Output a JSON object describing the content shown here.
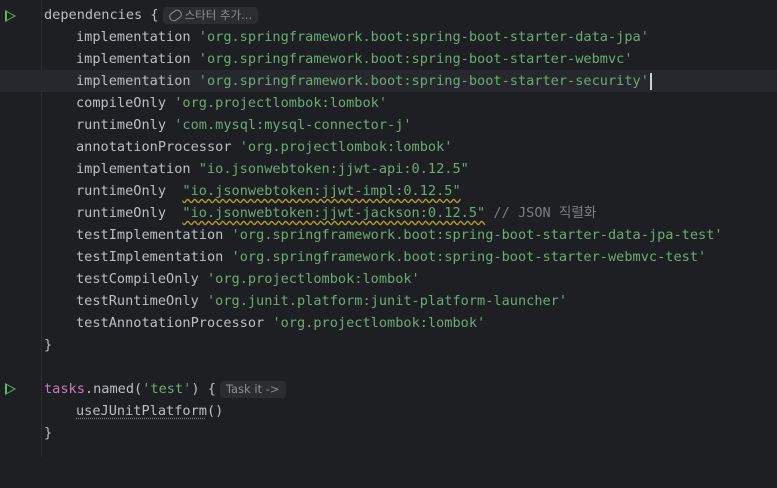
{
  "editor": {
    "lines": [
      {
        "kw": "dependencies {",
        "hint": "스타터 추가..."
      },
      {
        "fn": "implementation",
        "s": "'org.springframework.boot:spring-boot-starter-data-jpa'"
      },
      {
        "fn": "implementation",
        "s": "'org.springframework.boot:spring-boot-starter-webmvc'"
      },
      {
        "fn": "implementation",
        "s": "'org.springframework.boot:spring-boot-starter-security'"
      },
      {
        "fn": "compileOnly",
        "s": "'org.projectlombok:lombok'"
      },
      {
        "fn": "runtimeOnly",
        "s": "'com.mysql:mysql-connector-j'"
      },
      {
        "fn": "annotationProcessor",
        "s": "'org.projectlombok:lombok'"
      },
      {
        "fn": "implementation",
        "s": "\"io.jsonwebtoken:jjwt-api:0.12.5\""
      },
      {
        "fn": "runtimeOnly ",
        "s": "\"io.jsonwebtoken:jjwt-impl:0.12.5\""
      },
      {
        "fn": "runtimeOnly ",
        "s": "\"io.jsonwebtoken:jjwt-jackson:0.12.5\"",
        "c": "// JSON 직렬화"
      },
      {
        "fn": "testImplementation",
        "s": "'org.springframework.boot:spring-boot-starter-data-jpa-test'"
      },
      {
        "fn": "testImplementation",
        "s": "'org.springframework.boot:spring-boot-starter-webmvc-test'"
      },
      {
        "fn": "testCompileOnly",
        "s": "'org.projectlombok:lombok'"
      },
      {
        "fn": "testRuntimeOnly",
        "s": "'org.junit.platform:junit-platform-launcher'"
      },
      {
        "fn": "testAnnotationProcessor",
        "s": "'org.projectlombok:lombok'"
      },
      {
        "kw": "}"
      },
      {
        "kw": ""
      },
      {
        "tasks": "tasks",
        "named": ".named(",
        "arg": "'test'",
        "end": ") {",
        "hint": "Task it ->"
      },
      {
        "call": "useJUnitPlatform",
        "paren": "()"
      },
      {
        "kw": "}"
      }
    ]
  }
}
